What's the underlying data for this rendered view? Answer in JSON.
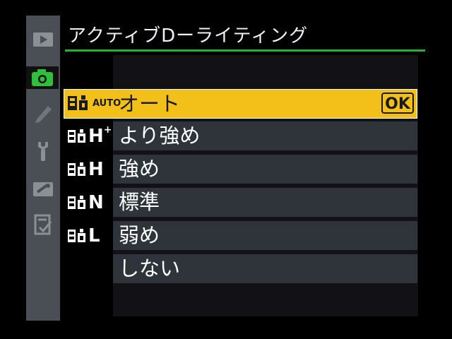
{
  "title": "アクティブDーライティング",
  "sidebar": {
    "items": [
      {
        "icon": "playback-icon",
        "active": false
      },
      {
        "icon": "camera-icon",
        "active": true
      },
      {
        "icon": "pencil-icon",
        "active": false
      },
      {
        "icon": "wrench-icon",
        "active": false
      },
      {
        "icon": "retouch-icon",
        "active": false
      },
      {
        "icon": "my-menu-icon",
        "active": false
      }
    ]
  },
  "menu": {
    "selected": {
      "icon_label": "AUTO",
      "label": "オート",
      "confirm": "OK"
    },
    "options": [
      {
        "code": "H",
        "sup": "+",
        "label": "より強め"
      },
      {
        "code": "H",
        "sup": "",
        "label": "強め"
      },
      {
        "code": "N",
        "sup": "",
        "label": "標準"
      },
      {
        "code": "L",
        "sup": "",
        "label": "弱め"
      },
      {
        "code": "",
        "sup": "",
        "label": "しない"
      }
    ]
  },
  "colors": {
    "accent": "#f3c01a",
    "title_line": "#1fb32e",
    "sidebar": "#4a4f56",
    "row": "#2f343a"
  }
}
